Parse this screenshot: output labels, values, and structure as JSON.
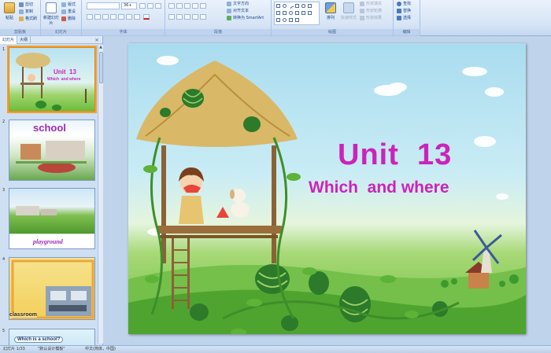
{
  "ribbon": {
    "clipboard": {
      "label": "剪贴板",
      "paste": "粘贴",
      "cut": "剪切",
      "copy": "复制",
      "format_painter": "格式刷"
    },
    "slides": {
      "label": "幻灯片",
      "new_slide": "新建幻灯片",
      "layout": "版式",
      "reset": "重设",
      "delete": "删除"
    },
    "font": {
      "label": "字体",
      "font_size": "36+"
    },
    "paragraph": {
      "label": "段落",
      "text_direction": "文字方向",
      "align_text": "对齐文本",
      "smartart": "转换为 SmartArt"
    },
    "drawing": {
      "label": "绘图",
      "arrange": "排列",
      "quick_styles": "快速样式",
      "shape_fill": "形状填充",
      "shape_outline": "形状轮廓",
      "shape_effects": "形状效果"
    },
    "editing": {
      "label": "编辑",
      "find": "查找",
      "replace": "替换",
      "select": "选择"
    }
  },
  "panel": {
    "tab_slides": "幻灯片",
    "tab_outline": "大纲",
    "close": "×",
    "thumbs": [
      {
        "num": "1",
        "title": "Unit  13",
        "subtitle": "Which  and where"
      },
      {
        "num": "2",
        "title": "school"
      },
      {
        "num": "3",
        "title": "playground"
      },
      {
        "num": "4",
        "title": "classroom"
      },
      {
        "num": "5",
        "title": "Which is a school?"
      }
    ]
  },
  "slide": {
    "title": "Unit  13",
    "subtitle": "Which  and where"
  },
  "status": {
    "slide_count": "幻灯片 1/33",
    "theme": "\"默认设计模板\"",
    "language": "中文(简体，中国)"
  },
  "colors": {
    "title_magenta": "#cc22bb",
    "ribbon_blue": "#15428b",
    "selected_border": "#f0a030"
  },
  "icons": [
    "paste-icon",
    "new-slide-icon",
    "arrange-icon",
    "find-icon",
    "close-icon",
    "windmill-icon",
    "watermelon-icon"
  ]
}
